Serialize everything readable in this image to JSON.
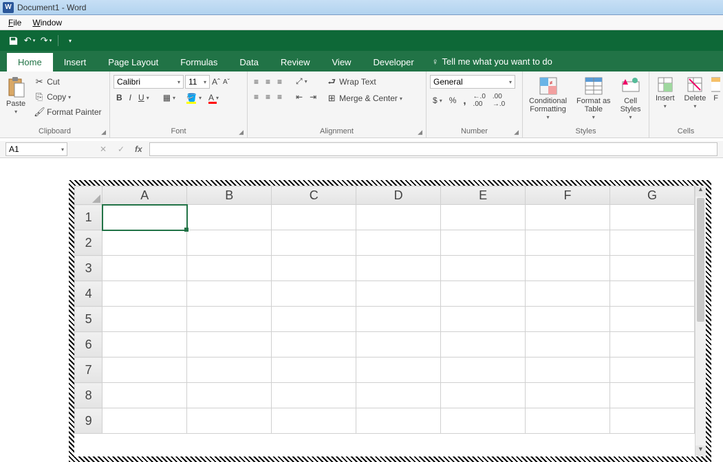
{
  "title": "Document1 - Word",
  "menubar": {
    "file": "File",
    "window": "Window"
  },
  "tabs": [
    "Home",
    "Insert",
    "Page Layout",
    "Formulas",
    "Data",
    "Review",
    "View",
    "Developer"
  ],
  "tell_me": "Tell me what you want to do",
  "clipboard": {
    "paste": "Paste",
    "cut": "Cut",
    "copy": "Copy",
    "format_painter": "Format Painter",
    "group": "Clipboard"
  },
  "font": {
    "name": "Calibri",
    "size": "11",
    "group": "Font"
  },
  "alignment": {
    "wrap": "Wrap Text",
    "merge": "Merge & Center",
    "group": "Alignment"
  },
  "number": {
    "format": "General",
    "group": "Number"
  },
  "styles": {
    "conditional": "Conditional\nFormatting",
    "format_as": "Format as\nTable",
    "cell_styles": "Cell\nStyles",
    "group": "Styles"
  },
  "cells": {
    "insert": "Insert",
    "delete": "Delete",
    "format_shown": "F",
    "group": "Cells"
  },
  "name_box": "A1",
  "sheet": {
    "cols": [
      "A",
      "B",
      "C",
      "D",
      "E",
      "F",
      "G"
    ],
    "rows": [
      "1",
      "2",
      "3",
      "4",
      "5",
      "6",
      "7",
      "8",
      "9"
    ],
    "selected": "A1"
  }
}
